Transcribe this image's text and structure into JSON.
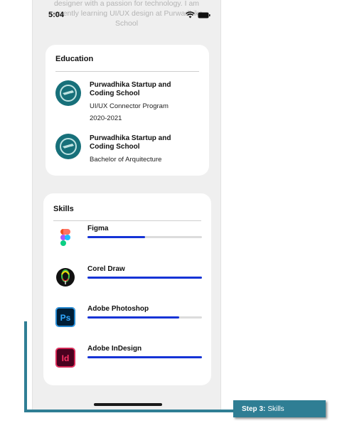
{
  "status_bar": {
    "time": "5:04"
  },
  "bio": {
    "line1": "designer with a passion for technology. I am",
    "line2": "currently learning UI/UX design at Purwadhika",
    "line3": "School"
  },
  "education": {
    "title": "Education",
    "items": [
      {
        "name": "Purwadhika Startup and Coding School",
        "program": "UI/UX Connector Program",
        "years": "2020-2021"
      },
      {
        "name": "Purwadhika Startup and Coding School",
        "program": "Bachelor of Arquitecture"
      }
    ]
  },
  "skills": {
    "title": "Skills",
    "items": [
      {
        "name": "Figma",
        "level": 0.5,
        "icon": "figma-icon"
      },
      {
        "name": "Corel Draw",
        "level": 1.0,
        "icon": "coreldraw-icon"
      },
      {
        "name": "Adobe Photoshop",
        "level": 0.8,
        "icon": "photoshop-icon",
        "icon_text": "Ps"
      },
      {
        "name": "Adobe InDesign",
        "level": 1.0,
        "icon": "indesign-icon",
        "icon_text": "Id"
      }
    ]
  },
  "annotation": {
    "step": "Step 3:",
    "label": "Skills"
  },
  "colors": {
    "accent": "#1533d6",
    "callout": "#2f7e94",
    "logo": "#17707a"
  }
}
